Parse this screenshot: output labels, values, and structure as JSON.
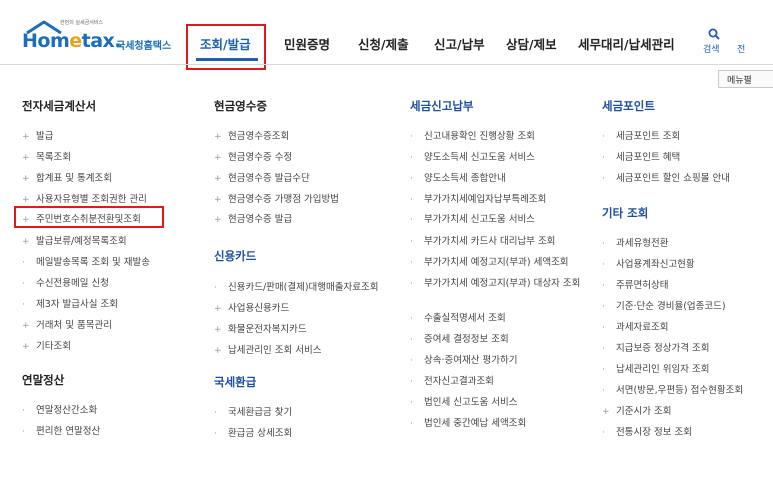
{
  "header": {
    "logo_tagline": "한번의 실세금서비스",
    "logo_text_pre": "Hom",
    "logo_text_e": "e",
    "logo_text_post": "tax.",
    "logo_kr": "국세청홈택스",
    "search_label": "검색",
    "cut_label": "전",
    "nav": [
      {
        "label": "조회/발급",
        "active": true
      },
      {
        "label": "민원증명",
        "active": false
      },
      {
        "label": "신청/제출",
        "active": false
      },
      {
        "label": "신고/납부",
        "active": false
      },
      {
        "label": "상담/제보",
        "active": false
      },
      {
        "label": "세무대리/납세관리",
        "active": false
      }
    ],
    "menu_button": "메뉴펼"
  },
  "columns": {
    "col1": {
      "sections": [
        {
          "title": "전자세금계산서",
          "items": [
            {
              "bullet": "+",
              "label": "발급"
            },
            {
              "bullet": "+",
              "label": "목록조회"
            },
            {
              "bullet": "+",
              "label": "합계표 및 통계조회"
            },
            {
              "bullet": "+",
              "label": "사용자유형별 조회권한 관리"
            },
            {
              "bullet": "+",
              "label": "주민번호수취분전환및조회"
            },
            {
              "bullet": "+",
              "label": "발급보류/예정목록조회"
            },
            {
              "bullet": "·",
              "label": "메일발송목록 조회 및 재발송"
            },
            {
              "bullet": "·",
              "label": "수신전용메일 신청"
            },
            {
              "bullet": "·",
              "label": "제3자 발급사실 조회"
            },
            {
              "bullet": "+",
              "label": "거래처 및 품목관리"
            },
            {
              "bullet": "+",
              "label": "기타조회"
            }
          ]
        },
        {
          "title": "연말정산",
          "items": [
            {
              "bullet": "·",
              "label": "연말정산간소화"
            },
            {
              "bullet": "·",
              "label": "편리한 연말정산"
            }
          ]
        }
      ]
    },
    "col2": {
      "sections": [
        {
          "title": "현금영수증",
          "items": [
            {
              "bullet": "+",
              "label": "현금영수증조회"
            },
            {
              "bullet": "+",
              "label": "현금영수증 수정"
            },
            {
              "bullet": "+",
              "label": "현금영수증 발급수단"
            },
            {
              "bullet": "+",
              "label": "현금영수증 가맹점 가입방법"
            },
            {
              "bullet": "+",
              "label": "현금영수증 발급"
            }
          ]
        },
        {
          "title": "신용카드",
          "items": [
            {
              "bullet": "·",
              "label": "신용카드/판매(결제)대행매출자료조회"
            },
            {
              "bullet": "+",
              "label": "사업용신용카드"
            },
            {
              "bullet": "+",
              "label": "화물운전자복지카드"
            },
            {
              "bullet": "+",
              "label": "납세관리인 조회 서비스"
            }
          ]
        },
        {
          "title": "국세환급",
          "items": [
            {
              "bullet": "·",
              "label": "국세환급금 찾기"
            },
            {
              "bullet": "·",
              "label": "환급금 상세조회"
            }
          ]
        }
      ]
    },
    "col3": {
      "sections": [
        {
          "title": "세금신고납부",
          "items": [
            {
              "bullet": "·",
              "label": "신고내용확인 진행상황 조회"
            },
            {
              "bullet": "·",
              "label": "양도소득세 신고도움 서비스"
            },
            {
              "bullet": "·",
              "label": "양도소득세 종합안내"
            },
            {
              "bullet": "·",
              "label": "부가가치세예입자납부특례조회"
            },
            {
              "bullet": "·",
              "label": "부가가치세 신고도움 서비스"
            },
            {
              "bullet": "·",
              "label": "부가가치세 카드사 대리납부 조회"
            },
            {
              "bullet": "·",
              "label": "부가가치세 예정고지(부과) 세액조회"
            },
            {
              "bullet": "·",
              "label": "부가가치세 예정고지(부과) 대상자 조회"
            },
            {
              "bullet": "·",
              "label": "수출실적명세서 조회"
            },
            {
              "bullet": "·",
              "label": "증여세 결정정보 조회"
            },
            {
              "bullet": "·",
              "label": "상속·증여재산 평가하기"
            },
            {
              "bullet": "·",
              "label": "전자신고결과조회"
            },
            {
              "bullet": "·",
              "label": "법인세 신고도움 서비스"
            },
            {
              "bullet": "·",
              "label": "법인세 중간예납 세액조회"
            }
          ]
        }
      ]
    },
    "col4": {
      "sections": [
        {
          "title": "세금포인트",
          "items": [
            {
              "bullet": "·",
              "label": "세금포인트 조회"
            },
            {
              "bullet": "·",
              "label": "세금포인트 혜택"
            },
            {
              "bullet": "·",
              "label": "세금포인트 할인 쇼핑몰 안내"
            }
          ]
        },
        {
          "title": "기타 조회",
          "items": [
            {
              "bullet": "·",
              "label": "과세유형전환"
            },
            {
              "bullet": "·",
              "label": "사업용계좌신고현황"
            },
            {
              "bullet": "·",
              "label": "주류면허상태"
            },
            {
              "bullet": "·",
              "label": "기준·단순 경비율(업종코드)"
            },
            {
              "bullet": "·",
              "label": "과세자료조회"
            },
            {
              "bullet": "·",
              "label": "지급보증 정상가격 조회"
            },
            {
              "bullet": "·",
              "label": "납세관리인 위임자 조회"
            },
            {
              "bullet": "·",
              "label": "서면(방문,우편등) 접수현황조회"
            },
            {
              "bullet": "+",
              "label": "기준시가 조회"
            },
            {
              "bullet": "·",
              "label": "전통시장 정보 조회"
            }
          ]
        }
      ]
    }
  }
}
